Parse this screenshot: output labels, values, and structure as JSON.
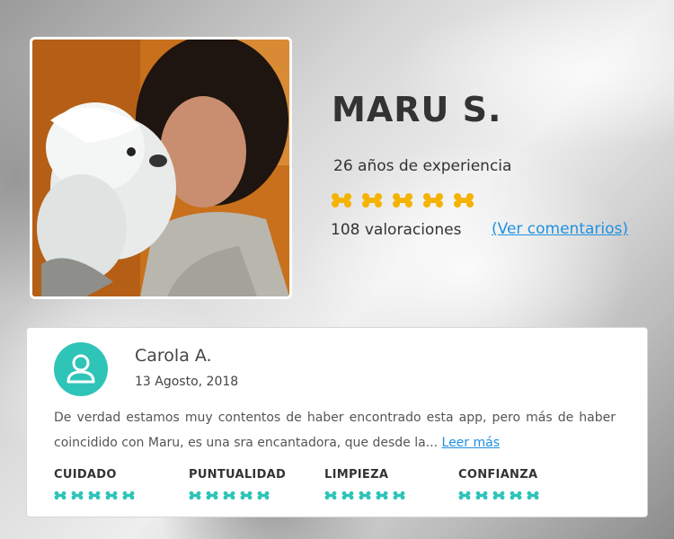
{
  "profile": {
    "name": "MARU S.",
    "experience": "26 años de experiencia",
    "rating": 5,
    "reviews_count": "108 valoraciones",
    "see_comments": "(Ver comentarios)"
  },
  "review": {
    "reviewer": "Carola A.",
    "date": "13 Agosto, 2018",
    "text": "De verdad estamos muy contentos de haber encontrado esta app, pero más de haber coincidido con Maru, es una sra encantadora, que desde la...",
    "read_more": "Leer más",
    "criteria": [
      {
        "label": "CUIDADO",
        "rating": 5
      },
      {
        "label": "PUNTUALIDAD",
        "rating": 5
      },
      {
        "label": "LIMPIEZA",
        "rating": 5
      },
      {
        "label": "CONFIANZA",
        "rating": 5
      }
    ]
  },
  "colors": {
    "profile_bone": "#f5b301",
    "criteria_bone": "#2fc4b8",
    "link": "#1e90e0",
    "avatar": "#2fc4b8"
  },
  "icons": {
    "rating": "bone-icon",
    "avatar": "user-avatar-icon"
  }
}
